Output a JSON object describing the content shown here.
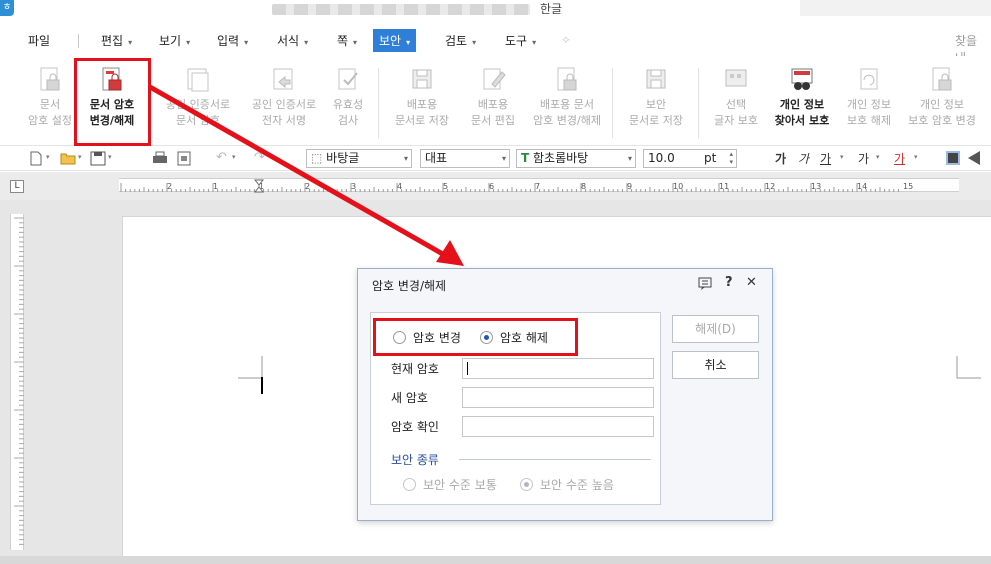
{
  "titlebar": {
    "app_icon": "ㅎ",
    "app_name": "한글"
  },
  "menu": {
    "items": [
      {
        "label": "파일",
        "caret": false
      },
      {
        "label": "편집",
        "caret": true
      },
      {
        "label": "보기",
        "caret": true
      },
      {
        "label": "입력",
        "caret": true
      },
      {
        "label": "서식",
        "caret": true
      },
      {
        "label": "쪽",
        "caret": true
      },
      {
        "label": "보안",
        "caret": true,
        "active": true
      },
      {
        "label": "검토",
        "caret": true
      },
      {
        "label": "도구",
        "caret": true
      }
    ],
    "search_hint": "찾을 내"
  },
  "ribbon": {
    "buttons": [
      {
        "label": "문서\n암호 설정",
        "enabled": false,
        "icon": "document-lock-icon"
      },
      {
        "label": "문서 암호\n변경/해제",
        "enabled": true,
        "icon": "document-lock-red-icon"
      },
      {
        "label": "공인 인증서로\n문서 암호",
        "enabled": false,
        "icon": "certificate-doc-icon"
      },
      {
        "label": "공인 인증서로\n전자 서명",
        "enabled": false,
        "icon": "certificate-sign-icon"
      },
      {
        "label": "유효성\n검사",
        "enabled": false,
        "icon": "validate-icon"
      },
      {
        "label": "배포용\n문서로 저장",
        "enabled": false,
        "icon": "distribute-save-icon"
      },
      {
        "label": "배포용\n문서 편집",
        "enabled": false,
        "icon": "distribute-edit-icon"
      },
      {
        "label": "배포용 문서\n암호 변경/해제",
        "enabled": false,
        "icon": "distribute-lock-icon"
      },
      {
        "label": "보안\n문서로 저장",
        "enabled": false,
        "icon": "secure-save-icon"
      },
      {
        "label": "선택\n글자 보호",
        "enabled": false,
        "icon": "text-protect-icon"
      },
      {
        "label": "개인 정보\n찾아서 보호",
        "enabled": true,
        "icon": "privacy-find-icon"
      },
      {
        "label": "개인 정보\n보호 해제",
        "enabled": false,
        "icon": "privacy-unprotect-icon"
      },
      {
        "label": "개인 정보\n보호 암호 변경",
        "enabled": false,
        "icon": "privacy-password-icon"
      }
    ]
  },
  "toolbar": {
    "style_combo": "바탕글",
    "lang_combo": "대표",
    "font_combo": "함초롬바탕",
    "size_value": "10.0",
    "size_unit": "pt",
    "font_badge": "T",
    "bold": "가",
    "italic": "가",
    "underline": "가",
    "strike": "가",
    "color": "가"
  },
  "ruler": {
    "labels": [
      "2",
      "1",
      "1",
      "2",
      "3",
      "4",
      "5",
      "6",
      "7",
      "8",
      "9",
      "10",
      "11",
      "12",
      "13",
      "14",
      "15"
    ],
    "corner": "L"
  },
  "dialog": {
    "title": "암호 변경/해제",
    "controls": {
      "help": "?",
      "close": "✕"
    },
    "radio_change": "암호 변경",
    "radio_remove": "암호 해제",
    "selected": "remove",
    "current_pw_label": "현재 암호",
    "new_pw_label": "새 암호",
    "confirm_pw_label": "암호 확인",
    "security_group": "보안 종류",
    "security_normal": "보안 수준 보통",
    "security_high": "보안 수준 높음",
    "ok_button": "해제(D)",
    "cancel_button": "취소"
  },
  "colors": {
    "accent": "#2f7fd8",
    "highlight": "#e4111b",
    "group_label": "#2b4fa3"
  }
}
